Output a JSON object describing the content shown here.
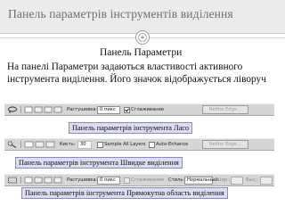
{
  "slide": {
    "title": "Панель параметрів інструментів виділення",
    "subtitle": "Панель Параметри",
    "body": "На панелі Параметри задаються властивості активного інструмента виділення. Його значок відображується ліворуч"
  },
  "toolbars": {
    "lasso": {
      "caption": "Панель параметрів інструмента Ласо",
      "feather_label": "Растушевка:",
      "feather_value": "0 пикс",
      "antialias_label": "Сглаживание",
      "refine_button": "Refine Edge..."
    },
    "quick": {
      "caption": "Панель параметрів інструмента Швидке виділення",
      "brush_label": "Кисть:",
      "brush_size": "30",
      "sample_label": "Sample All Layers",
      "enhance_label": "Auto-Enhance",
      "refine_button": "Refine Edge..."
    },
    "rect": {
      "caption": "Панель параметрів інструмента Прямокутна область виділення",
      "feather_label": "Растушевка:",
      "feather_value": "0 пикс",
      "antialias_label": "Сглаживание",
      "style_label": "Стиль:",
      "style_value": "Нормальный",
      "width_label": "Шир.:",
      "height_label": "Выс.:"
    }
  },
  "colors": {
    "header_bg": "#ebebeb",
    "title_text": "#6f6f6f",
    "caption_bg": "#dcdcf2",
    "caption_border": "#8a8ab8",
    "toolbar_bg": "#d6d6d6"
  }
}
